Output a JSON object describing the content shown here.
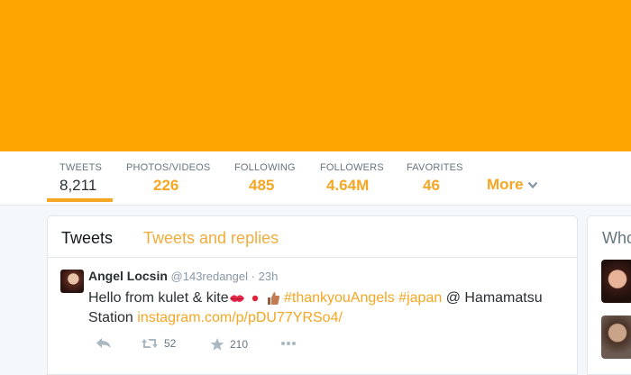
{
  "colors": {
    "accent": "#f5a623",
    "banner": "#ffa500",
    "tab_inactive": "#f0ad3c"
  },
  "nav": {
    "stats": [
      {
        "label": "TWEETS",
        "value": "8,211"
      },
      {
        "label": "PHOTOS/VIDEOS",
        "value": "226"
      },
      {
        "label": "FOLLOWING",
        "value": "485"
      },
      {
        "label": "FOLLOWERS",
        "value": "4.64M"
      },
      {
        "label": "FAVORITES",
        "value": "46"
      }
    ],
    "more_label": "More"
  },
  "timeline": {
    "tabs": [
      {
        "label": "Tweets"
      },
      {
        "label": "Tweets and replies"
      }
    ],
    "tweet": {
      "name": "Angel Locsin",
      "handle": "@143redangel",
      "separator": "·",
      "time": "23h",
      "text_intro": "Hello from kulet & kite",
      "hashtag1": "#thankyouAngels",
      "hashtag2": "#japan",
      "location": "@ Hamamatsu Station",
      "link": "instagram.com/p/pDU77YRSo4/",
      "retweets": "52",
      "favorites": "210"
    }
  },
  "sidebar": {
    "title": "Who"
  }
}
